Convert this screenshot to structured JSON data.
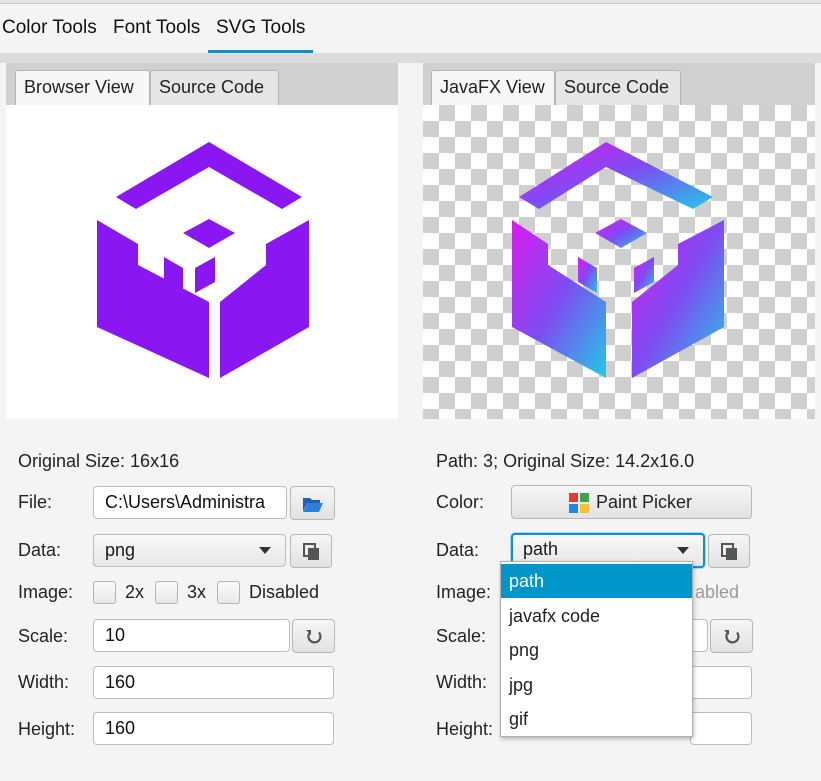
{
  "main_tabs": [
    {
      "label": "Color Tools"
    },
    {
      "label": "Font Tools"
    },
    {
      "label": "SVG Tools"
    }
  ],
  "selected_main_tab": "SVG Tools",
  "left": {
    "tabs": [
      {
        "label": "Browser View"
      },
      {
        "label": "Source Code"
      }
    ],
    "original_size": "Original Size: 16x16",
    "file_label": "File:",
    "file_value": "C:\\Users\\Administra",
    "data_label": "Data:",
    "data_value": "png",
    "image_label": "Image:",
    "opt_2x": "2x",
    "opt_3x": "3x",
    "opt_disabled": "Disabled",
    "scale_label": "Scale:",
    "scale_value": "10",
    "width_label": "Width:",
    "width_value": "160",
    "height_label": "Height:",
    "height_value": "160"
  },
  "right": {
    "tabs": [
      {
        "label": "JavaFX View"
      },
      {
        "label": "Source Code"
      }
    ],
    "path_label": "Path:",
    "path_count": "3",
    "original_size": "; Original Size: 14.2x16.0",
    "color_label": "Color:",
    "paint_picker": "Paint Picker",
    "data_label": "Data:",
    "data_value": "path",
    "image_label": "Image:",
    "disabled_partial": "abled",
    "scale_label": "Scale:",
    "width_label": "Width:",
    "height_label": "Height:"
  },
  "dropdown": {
    "options": [
      {
        "label": "path"
      },
      {
        "label": "javafx code"
      },
      {
        "label": "png"
      },
      {
        "label": "jpg"
      },
      {
        "label": "gif"
      }
    ],
    "selected": "path"
  },
  "colors": {
    "accent": "#0f8fd1",
    "logo_purple": "#8a16f2",
    "gradient_magenta": "#d91bf0",
    "gradient_violet": "#7e4cf2",
    "gradient_cyan": "#22c9e6",
    "dropdown_selected": "#0096c9"
  }
}
